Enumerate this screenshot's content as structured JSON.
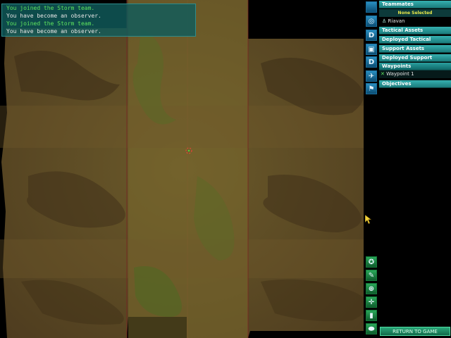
{
  "chat": {
    "lines": [
      {
        "text": "You joined the Storm team.",
        "color": "#5fe65f"
      },
      {
        "text": "You have become an observer.",
        "color": "#e6e6e6"
      },
      {
        "text": "You joined the Storm team.",
        "color": "#5fe65f"
      },
      {
        "text": "You have become an observer.",
        "color": "#e6e6e6"
      }
    ]
  },
  "toolbar_top": [
    {
      "name": "player-icon",
      "label": ""
    },
    {
      "name": "target-icon",
      "label": ""
    },
    {
      "name": "deploy-icon",
      "label": "D"
    },
    {
      "name": "box-icon",
      "label": ""
    },
    {
      "name": "deploy-icon-2",
      "label": "D"
    },
    {
      "name": "aircraft-icon",
      "label": ""
    },
    {
      "name": "soldier-icon",
      "label": ""
    }
  ],
  "toolbar_bottom": [
    {
      "name": "compass-icon",
      "label": ""
    },
    {
      "name": "wrench-icon",
      "label": ""
    },
    {
      "name": "zoom-icon",
      "label": ""
    },
    {
      "name": "crosshair-icon",
      "label": ""
    },
    {
      "name": "bar-icon",
      "label": ""
    },
    {
      "name": "vehicle-icon",
      "label": ""
    }
  ],
  "panel": {
    "teammates_label": "Teammates",
    "none_selected": "None Selected",
    "player_name": "Riavan",
    "tactical_assets": "Tactical Assets",
    "deployed_tactical": "Deployed Tactical",
    "support_assets": "Support Assets",
    "deployed_support": "Deployed Support",
    "waypoints_label": "Waypoints",
    "waypoint_item": "Waypoint 1",
    "objectives_label": "Objectives"
  },
  "return_button": "RETURN TO GAME",
  "colors": {
    "panel_header": "#1b7c7c",
    "accent_green": "#5fe65f",
    "terrain_brown": "#5e4a24"
  }
}
